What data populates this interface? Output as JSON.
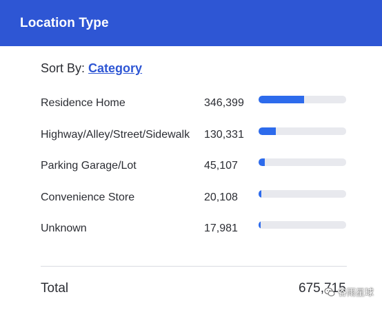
{
  "header": {
    "title": "Location Type"
  },
  "sort": {
    "label": "Sort By:",
    "value": "Category"
  },
  "rows": [
    {
      "label": "Residence Home",
      "value": "346,399",
      "fill": 0.52
    },
    {
      "label": "Highway/Alley/Street/Sidewalk",
      "value": "130,331",
      "fill": 0.195
    },
    {
      "label": "Parking Garage/Lot",
      "value": "45,107",
      "fill": 0.067
    },
    {
      "label": "Convenience Store",
      "value": "20,108",
      "fill": 0.03
    },
    {
      "label": "Unknown",
      "value": "17,981",
      "fill": 0.027
    }
  ],
  "footer": {
    "total_label": "Total",
    "total_value": "675,715"
  },
  "watermark": {
    "text": "谷雨星球",
    "icon": "wechat-icon"
  },
  "colors": {
    "header_bg": "#2e56d4",
    "accent": "#2e56d4",
    "bar_fill": "#2d6bec",
    "bar_track": "#e8e9ee"
  }
}
